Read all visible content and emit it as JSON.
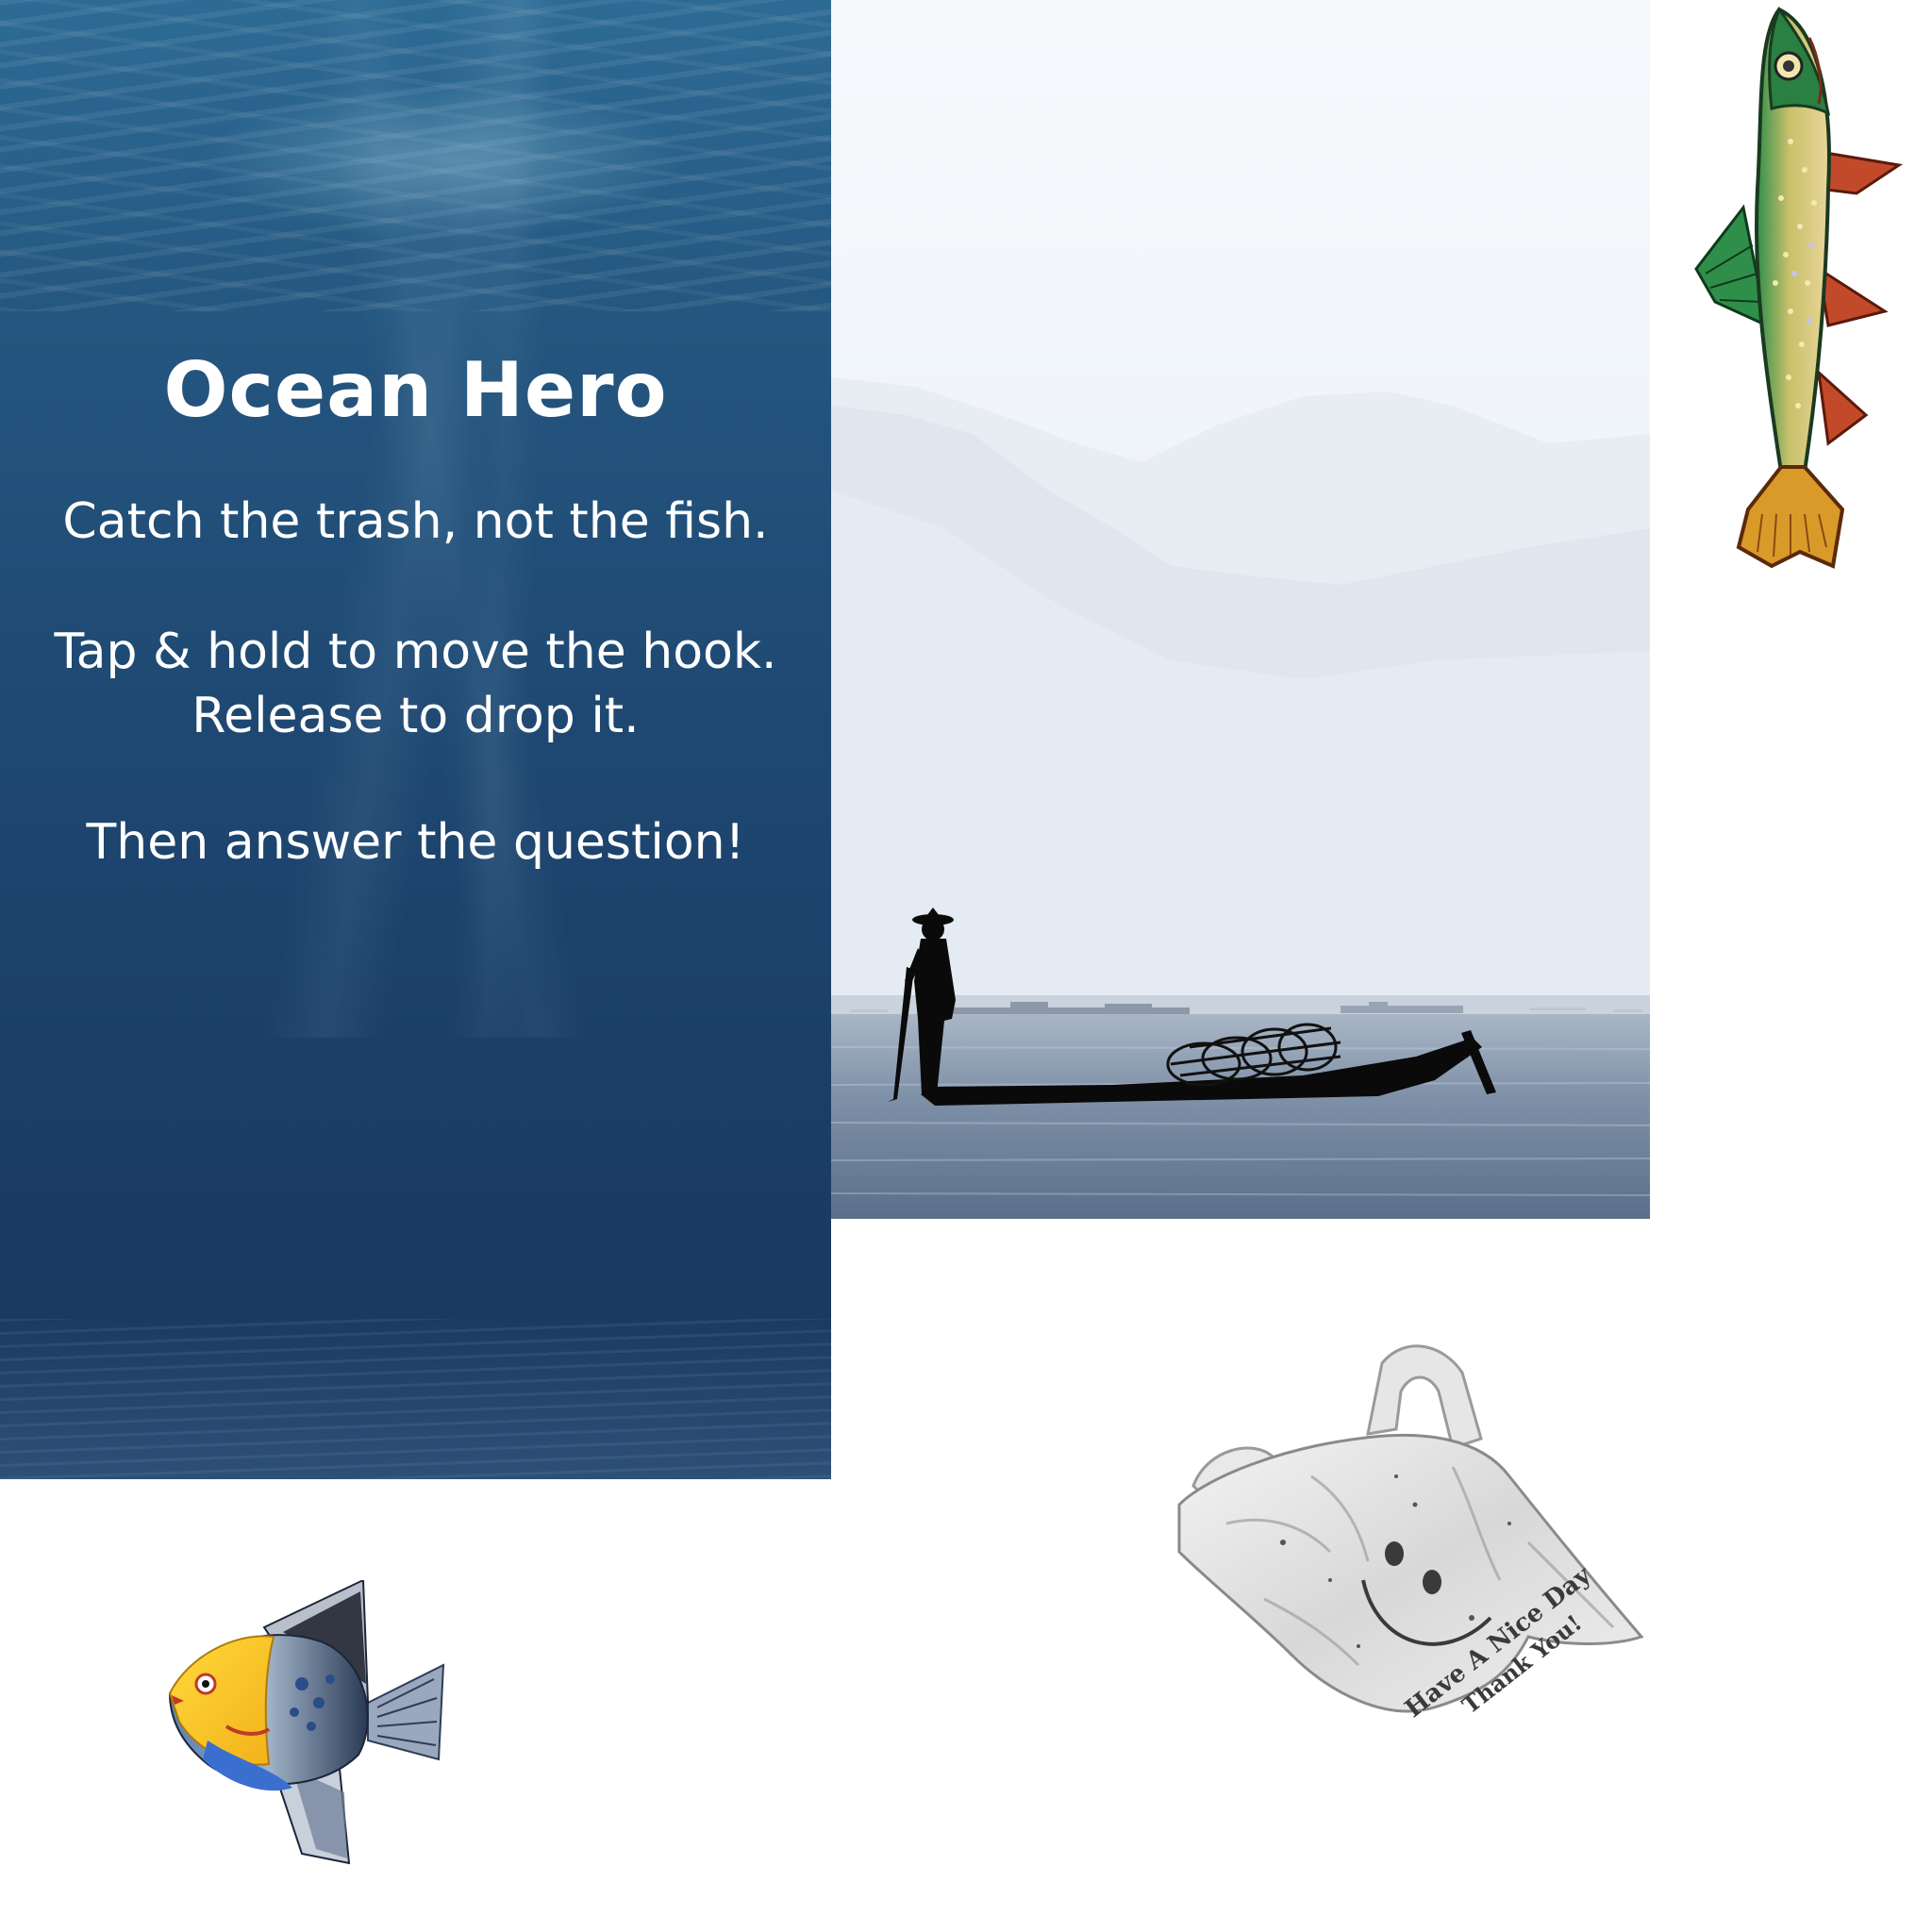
{
  "game": {
    "title": "Ocean Hero",
    "instructions": {
      "line1": "Catch the trash, not the fish.",
      "line2": "Tap & hold to move the hook.",
      "line3": "Release to drop it.",
      "line4": "Then answer the question!"
    }
  },
  "sprites": {
    "trout": "trout-sprite",
    "angelfish": "angelfish-sprite",
    "plastic_bag": "plastic-bag-sprite",
    "fisherman_photo": "fisherman-boat-photo"
  },
  "bag_print": {
    "line1": "Have A Nice Day",
    "line2": "Thank You!"
  },
  "colors": {
    "ocean_top": "#2d6b95",
    "ocean_bottom": "#1a3a62",
    "text": "#ffffff",
    "background": "#ffffff"
  }
}
